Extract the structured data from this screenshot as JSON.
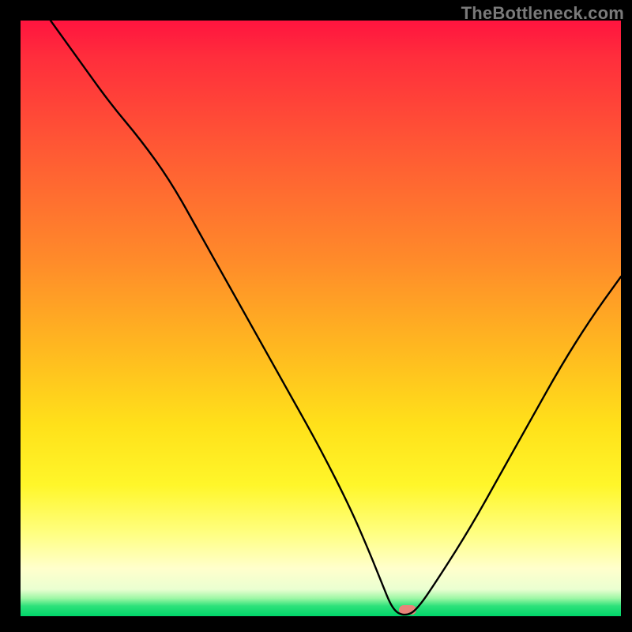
{
  "watermark": "TheBottleneck.com",
  "marker": {
    "x_pct": 64.5,
    "y_pct": 99.0
  },
  "colors": {
    "frame": "#000000",
    "marker": "#e9837a",
    "curve": "#000000",
    "gradient_stops": [
      "#ff143f",
      "#ff2d3c",
      "#ff5a34",
      "#ff8a2a",
      "#ffb820",
      "#ffe11a",
      "#fff62a",
      "#ffff80",
      "#ffffcc",
      "#eaffd1",
      "#9df7a5",
      "#2de17a",
      "#00d66a"
    ]
  },
  "chart_data": {
    "type": "line",
    "title": "",
    "xlabel": "",
    "ylabel": "",
    "xlim": [
      0,
      100
    ],
    "ylim": [
      0,
      100
    ],
    "note": "A bottleneck-style V curve; x in % of width, y as mismatch % (0 = no bottleneck). Minimum at ~62–66%. Values are estimates read from the image.",
    "series": [
      {
        "name": "bottleneck-curve",
        "x": [
          5,
          10,
          15,
          20,
          25,
          30,
          35,
          40,
          45,
          50,
          55,
          58,
          60,
          62,
          64,
          66,
          70,
          75,
          80,
          85,
          90,
          95,
          100
        ],
        "y": [
          100,
          93,
          86,
          80,
          73,
          64,
          55,
          46,
          37,
          28,
          18,
          11,
          6,
          1,
          0,
          1,
          7,
          15,
          24,
          33,
          42,
          50,
          57
        ]
      }
    ],
    "marker_point": {
      "x": 64.5,
      "y": 0
    }
  }
}
